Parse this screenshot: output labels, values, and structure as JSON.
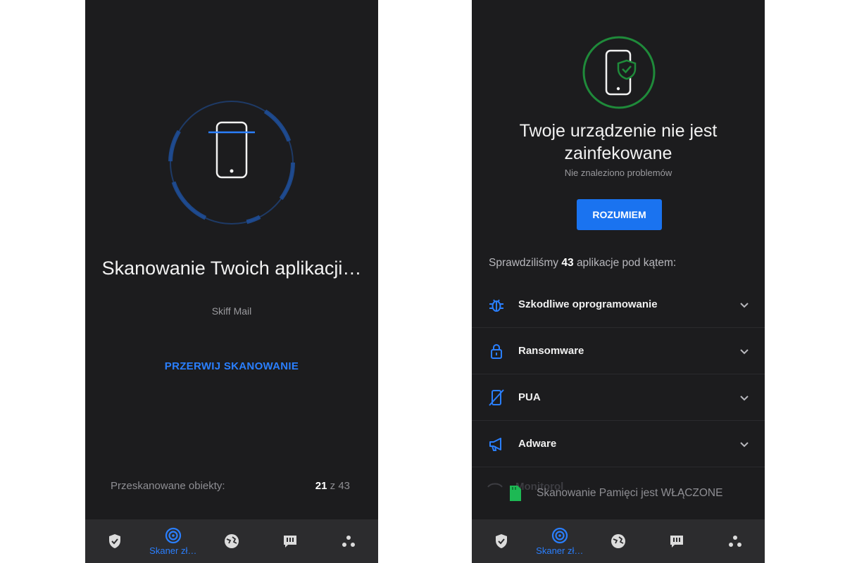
{
  "left_screen": {
    "title": "Skanowanie Twoich aplikacji…",
    "current_app": "Skiff Mail",
    "stop_button": "PRZERWIJ SKANOWANIE",
    "progress": {
      "label": "Przeskanowane obiekty:",
      "done": "21",
      "separator": "z",
      "total": "43"
    },
    "nav": {
      "active_label": "Skaner zł…"
    }
  },
  "right_screen": {
    "title": "Twoje urządzenie nie jest zainfekowane",
    "subtitle": "Nie znaleziono problemów",
    "ok_button": "ROZUMIEM",
    "checked": {
      "prefix": "Sprawdziliśmy",
      "count": "43",
      "suffix": "aplikacje pod kątem:"
    },
    "categories": [
      {
        "label": "Szkodliwe oprogramowanie",
        "icon": "bug-icon"
      },
      {
        "label": "Ransomware",
        "icon": "lock-icon"
      },
      {
        "label": "PUA",
        "icon": "crossed-phone-icon"
      },
      {
        "label": "Adware",
        "icon": "megaphone-icon"
      }
    ],
    "faded_item": "Monitorol",
    "toast": "Skanowanie Pamięci jest WŁĄCZONE",
    "nav": {
      "active_label": "Skaner zł…"
    }
  },
  "colors": {
    "background": "#1c1c1e",
    "nav_background": "#2c2c2e",
    "accent_blue": "#2a7fff",
    "button_blue": "#1a73f0",
    "success_green": "#1f8a3a",
    "sd_green": "#1db954"
  }
}
